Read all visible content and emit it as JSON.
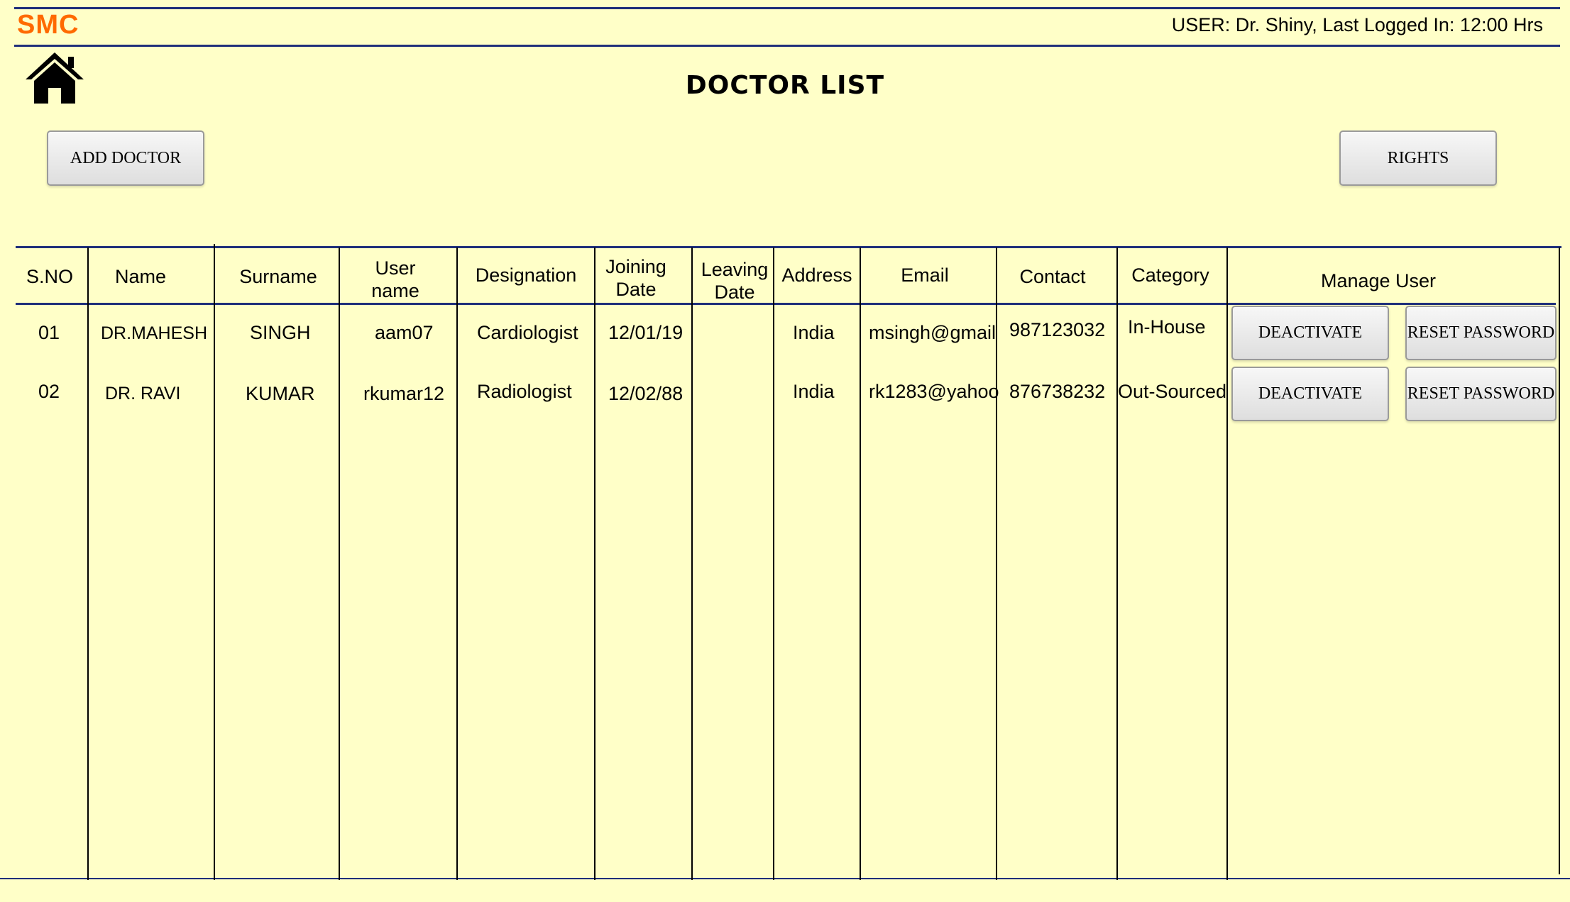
{
  "app": {
    "brand": "SMC",
    "user_info": "USER: Dr. Shiny, Last Logged In: 12:00 Hrs"
  },
  "page": {
    "title": "DOCTOR LIST",
    "home_icon": "home-icon"
  },
  "actions": {
    "add_doctor": "ADD DOCTOR",
    "rights": "RIGHTS"
  },
  "table": {
    "headers": {
      "sno": "S.NO",
      "name": "Name",
      "surname": "Surname",
      "username_line1": "User",
      "username_line2": "name",
      "designation": "Designation",
      "joining_line1": "Joining",
      "joining_line2": "Date",
      "leaving_line1": "Leaving",
      "leaving_line2": "Date",
      "address": "Address",
      "email": "Email",
      "contact": "Contact",
      "category": "Category",
      "manage": "Manage User"
    },
    "rows": [
      {
        "sno": "01",
        "name": "DR.MAHESH",
        "surname": "SINGH",
        "username": "aam07",
        "designation": "Cardiologist",
        "joining": "12/01/19",
        "leaving": "",
        "address": "India",
        "email": "msingh@gmail",
        "contact": "987123032",
        "category": "In-House",
        "deactivate": "DEACTIVATE",
        "reset": "RESET PASSWORD"
      },
      {
        "sno": "02",
        "name": "DR. RAVI",
        "surname": "KUMAR",
        "username": "rkumar12",
        "designation": "Radiologist",
        "joining": "12/02/88",
        "leaving": "",
        "address": "India",
        "email": "rk1283@yahoo",
        "contact": "876738232",
        "category": "Out-Sourced",
        "deactivate": "DEACTIVATE",
        "reset": "RESET PASSWORD"
      }
    ]
  },
  "colors": {
    "background": "#ffffc8",
    "brand": "#ff6a00",
    "rule": "#1f2f7a"
  }
}
